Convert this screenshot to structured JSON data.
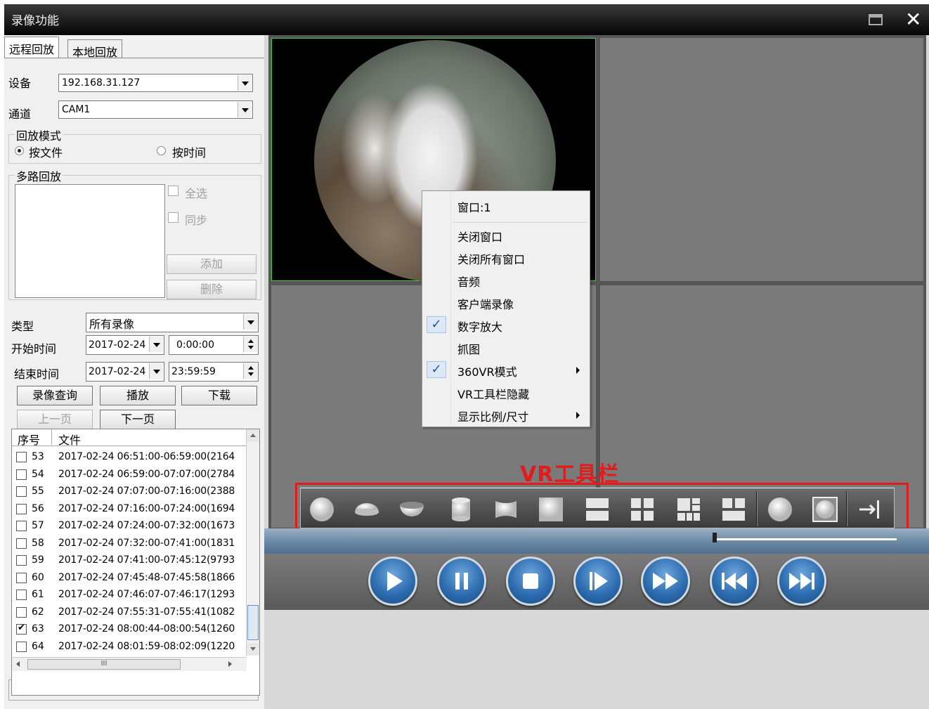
{
  "window": {
    "title": "录像功能"
  },
  "tabs": {
    "remote": "远程回放",
    "local": "本地回放"
  },
  "device": {
    "label": "设备",
    "value": "192.168.31.127"
  },
  "channel": {
    "label": "通道",
    "value": "CAM1"
  },
  "playback_mode": {
    "label": "回放模式",
    "by_file": "按文件",
    "by_time": "按时间"
  },
  "multi": {
    "label": "多路回放",
    "select_all": "全选",
    "sync": "同步",
    "add": "添加",
    "delete": "删除"
  },
  "type": {
    "label": "类型",
    "value": "所有录像"
  },
  "start": {
    "label": "开始时间",
    "date": "2017-02-24",
    "time": "0:00:00"
  },
  "end": {
    "label": "结束时间",
    "date": "2017-02-24",
    "time": "23:59:59"
  },
  "buttons": {
    "query": "录像查询",
    "play": "播放",
    "download": "下载",
    "prev": "上一页",
    "next": "下一页"
  },
  "filelist": {
    "col_index": "序号",
    "col_file": "文件",
    "hscroll_thumb": "III",
    "rows": [
      {
        "n": "53",
        "f": "2017-02-24 06:51:00-06:59:00(2164",
        "checked": false
      },
      {
        "n": "54",
        "f": "2017-02-24 06:59:00-07:07:00(2784",
        "checked": false
      },
      {
        "n": "55",
        "f": "2017-02-24 07:07:00-07:16:00(2388",
        "checked": false
      },
      {
        "n": "56",
        "f": "2017-02-24 07:16:00-07:24:00(1694",
        "checked": false
      },
      {
        "n": "57",
        "f": "2017-02-24 07:24:00-07:32:00(1673",
        "checked": false
      },
      {
        "n": "58",
        "f": "2017-02-24 07:32:00-07:41:00(1831",
        "checked": false
      },
      {
        "n": "59",
        "f": "2017-02-24 07:41:00-07:45:12(9793",
        "checked": false
      },
      {
        "n": "60",
        "f": "2017-02-24 07:45:48-07:45:58(1866",
        "checked": false
      },
      {
        "n": "61",
        "f": "2017-02-24 07:46:07-07:46:17(1293",
        "checked": false
      },
      {
        "n": "62",
        "f": "2017-02-24 07:55:31-07:55:41(1082",
        "checked": false
      },
      {
        "n": "63",
        "f": "2017-02-24 08:00:44-08:00:54(1260",
        "checked": true
      },
      {
        "n": "64",
        "f": "2017-02-24 08:01:59-08:02:09(1220",
        "checked": false
      }
    ]
  },
  "context_menu": {
    "items": [
      {
        "label": "窗口:1",
        "checked": false,
        "submenu": false
      },
      {
        "label": "关闭窗口",
        "checked": false,
        "submenu": false
      },
      {
        "label": "关闭所有窗口",
        "checked": false,
        "submenu": false
      },
      {
        "label": "音频",
        "checked": false,
        "submenu": false
      },
      {
        "label": "客户端录像",
        "checked": false,
        "submenu": false
      },
      {
        "label": "数字放大",
        "checked": true,
        "submenu": false
      },
      {
        "label": "抓图",
        "checked": false,
        "submenu": false
      },
      {
        "label": "360VR模式",
        "checked": true,
        "submenu": true
      },
      {
        "label": "VR工具栏隐藏",
        "checked": false,
        "submenu": false
      },
      {
        "label": "显示比例/尺寸",
        "checked": false,
        "submenu": true
      }
    ],
    "check_glyph": "✓"
  },
  "vr_toolbar": {
    "annotation": "VR工具栏",
    "annotation_color": "#e21b1b",
    "icons": [
      "sphere-icon",
      "half-sphere-icon",
      "bowl-icon",
      "cylinder-icon",
      "panorama-icon",
      "single-view-icon",
      "split-two-icon",
      "split-four-icon",
      "split-multi-icon",
      "split-three-icon",
      "circle-view-icon",
      "square-circle-icon",
      "exit-toolbar-icon"
    ]
  },
  "playback_controls": [
    "play-icon",
    "pause-icon",
    "stop-icon",
    "step-icon",
    "fast-forward-icon",
    "prev-file-icon",
    "next-file-icon"
  ],
  "colors": {
    "accent_green": "#3fd03f",
    "control_blue": "#2d6db0"
  }
}
